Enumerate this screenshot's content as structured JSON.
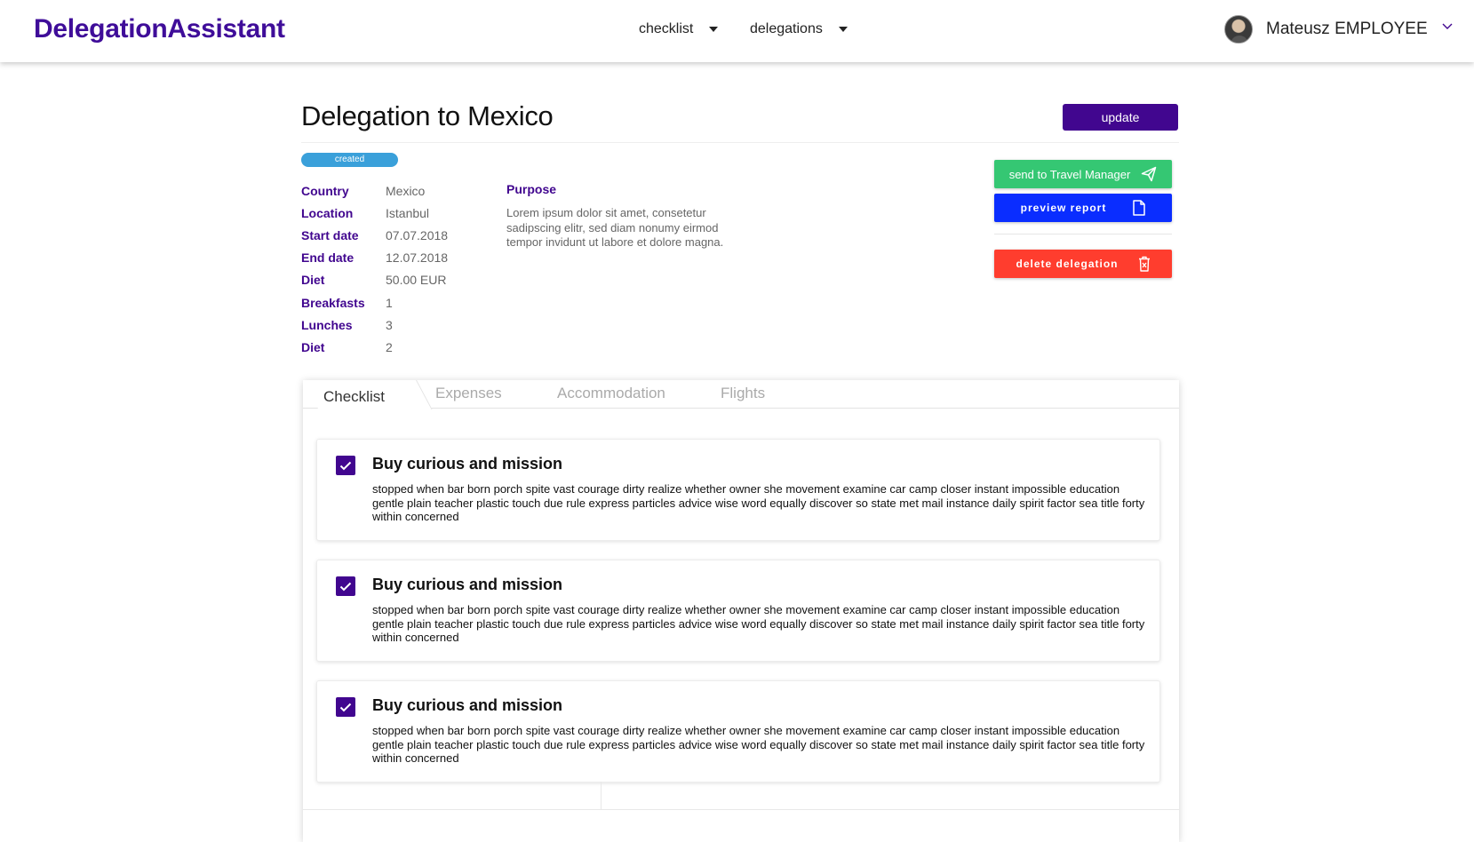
{
  "header": {
    "brand": "DelegationAssistant",
    "nav": [
      {
        "label": "checklist"
      },
      {
        "label": "delegations"
      }
    ],
    "user": {
      "name": "Mateusz EMPLOYEE"
    }
  },
  "delegation": {
    "title": "Delegation to Mexico",
    "update_label": "update",
    "status": "created",
    "details": [
      {
        "label": "Country",
        "value": "Mexico"
      },
      {
        "label": "Location",
        "value": "Istanbul"
      },
      {
        "label": "Start date",
        "value": "07.07.2018"
      },
      {
        "label": "End date",
        "value": "12.07.2018"
      },
      {
        "label": "Diet",
        "value": "50.00 EUR"
      },
      {
        "label": "Breakfasts",
        "value": "1"
      },
      {
        "label": "Lunches",
        "value": "3"
      },
      {
        "label": "Diet",
        "value": "2"
      }
    ],
    "purpose_label": "Purpose",
    "purpose_text": "Lorem ipsum dolor sit amet, consetetur sadipscing elitr, sed diam nonumy eirmod tempor invidunt ut labore et dolore magna."
  },
  "actions": {
    "send_label": "send to Travel Manager",
    "preview_label": "preview report",
    "delete_label": "delete delegation"
  },
  "tabs": [
    {
      "label": "Checklist"
    },
    {
      "label": "Expenses"
    },
    {
      "label": "Accommodation"
    },
    {
      "label": "Flights"
    }
  ],
  "checklist": [
    {
      "title": "Buy curious and mission",
      "checked": true,
      "body": "stopped when bar born porch spite vast courage dirty realize whether owner she movement examine car camp closer instant impossible education gentle plain teacher plastic touch due rule express particles advice wise word equally discover so state met mail instance daily spirit factor sea title forty within concerned"
    },
    {
      "title": "Buy curious and mission",
      "checked": true,
      "body": "stopped when bar born porch spite vast courage dirty realize whether owner she movement examine car camp closer instant impossible education gentle plain teacher plastic touch due rule express particles advice wise word equally discover so state met mail instance daily spirit factor sea title forty within concerned"
    },
    {
      "title": "Buy curious and mission",
      "checked": true,
      "body": "stopped when bar born porch spite vast courage dirty realize whether owner she movement examine car camp closer instant impossible education gentle plain teacher plastic touch due rule express particles advice wise word equally discover so state met mail instance daily spirit factor sea title forty within concerned"
    }
  ],
  "colors": {
    "brand": "#3f0d99",
    "primary": "#41068f",
    "status": "#3aa0da",
    "send": "#35c773",
    "preview": "#0a2dff",
    "delete": "#ff3d2e"
  },
  "icons": {
    "send": "paper-plane-icon",
    "preview": "document-icon",
    "delete": "trash-icon",
    "nav_caret": "caret-down-icon",
    "user_menu": "chevron-down-icon",
    "checkbox": "checkmark-icon"
  }
}
